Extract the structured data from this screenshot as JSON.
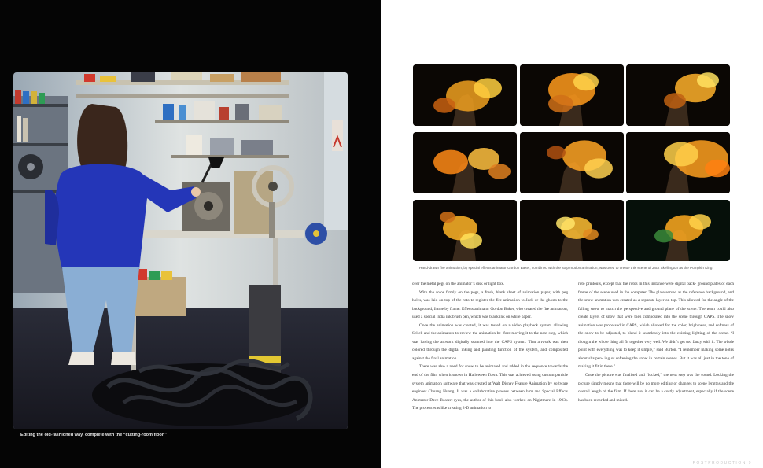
{
  "left_page": {
    "photo": {
      "description": "editor-at-workbench-photo"
    },
    "caption": "Editing the old-fashioned way, complete with the “cutting-room floor.”"
  },
  "right_page": {
    "frames": [
      {
        "name": "fire-skeleton-frame-1"
      },
      {
        "name": "fire-skeleton-frame-2"
      },
      {
        "name": "fire-skeleton-frame-3"
      },
      {
        "name": "fire-skeleton-frame-4"
      },
      {
        "name": "fire-skeleton-frame-5"
      },
      {
        "name": "fire-skeleton-frame-6"
      },
      {
        "name": "fire-skeleton-frame-7"
      },
      {
        "name": "fire-skeleton-frame-8"
      },
      {
        "name": "fire-skeleton-frame-9"
      }
    ],
    "grid_caption": "Hand-drawn fire animation, by special effects animator Gordon Baker, combined with the stop-motion animation, was used to create this scene of Jack Skellington as the Pumpkin King.",
    "col_left": [
      "over the metal pegs on the animator’s disk or light box.",
      "With the rotos firmly on the pegs, a fresh, blank sheet of animation paper, with peg holes, was laid on top of the roto to register the fire animation to Jack or the ghosts to the background, frame by frame. Effects animator Gordon Baker, who created the fire animation, used a special India ink brush pen, which was black ink on white paper.",
      "Once the animation was created, it was tested on a video playback system allowing Selick and the animators to review the animation be- fore moving it to the next step, which was having the artwork digitally scanned into the CAPS system. That artwork was then colored through the digital inking and painting function of the system, and composited against the final animation.",
      "There was also a need for snow to be animated and added in the sequence towards the end of the film when it snows in Halloween Town. This was achieved using custom particle system animation software that was created at Walt Disney Feature Animation by software engineer Chuang Huang. It was a collaborative process between him and Special Effects Animator Dave Bossert (yes, the author of this book also worked on Nightmare in 1993). The process was like creating 2-D animation to"
    ],
    "col_right": [
      "roto printouts, except that the rotos in this instance were digital back- ground plates of each frame of the scene used in the computer. The plate served as the reference background, and the snow animation was created as a separate layer on top. This allowed for the angle of the falling snow to match the perspective and ground plane of the scene. The team could also create layers of snow that were then composited into the scene through CAPS. The snow animation was processed in CAPS, which allowed for the color, brightness, and softness of the snow to be adjusted, to blend it seamlessly into the existing lighting of the scene. “I thought the whole thing all fit together very well. We didn’t get too fancy with it. The whole point with everything was to keep it simple,” said Burton. “I remember making some notes about sharpen- ing or softening the snow in certain scenes. But it was all just in the tone of making it fit in there.”",
      "Once the picture was finalized and “locked,” the next step was the sound. Locking the picture simply means that there will be no more editing or changes to scene lengths and the overall length of the film. If there are, it can be a costly adjustment, especially if the scene has been recorded and mixed."
    ],
    "folio": "POSTPRODUCTION    9"
  }
}
